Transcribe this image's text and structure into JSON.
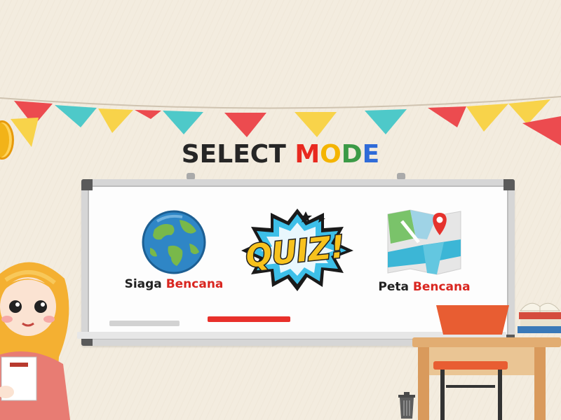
{
  "title": {
    "word1": "SELECT",
    "word2": [
      "M",
      "O",
      "D",
      "E"
    ],
    "word2_colors": [
      "#e8291f",
      "#f4b400",
      "#3b9a46",
      "#2f6bd8"
    ]
  },
  "modes": [
    {
      "id": "siaga",
      "label_main": "Siaga",
      "label_accent": "Bencana",
      "icon": "globe-icon"
    },
    {
      "id": "quiz",
      "label": "QUIZ!",
      "icon": "quiz-burst-icon"
    },
    {
      "id": "peta",
      "label_main": "Peta",
      "label_accent": "Bencana",
      "icon": "map-pin-icon"
    }
  ],
  "colors": {
    "accent": "#d92620",
    "flag_red": "#ec4b4f",
    "flag_teal": "#4ec9c9",
    "flag_yellow": "#f8d34a"
  }
}
